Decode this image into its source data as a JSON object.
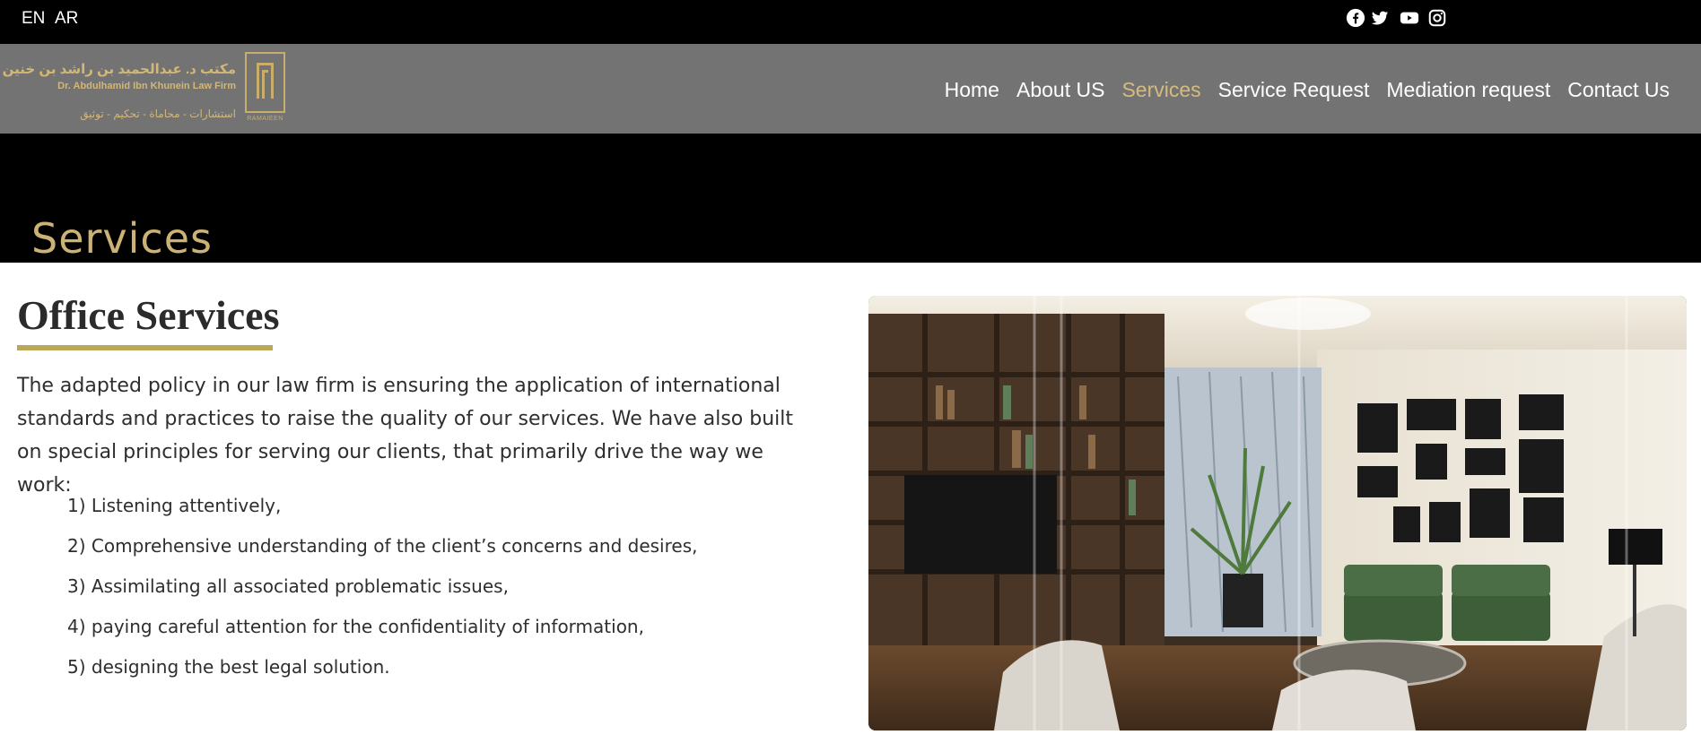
{
  "topbar": {
    "lang_en": "EN",
    "lang_ar": "AR",
    "social": [
      "facebook-icon",
      "twitter-icon",
      "youtube-icon",
      "instagram-icon"
    ]
  },
  "logo": {
    "arabic_name": "مكتب د. عبدالحميد بن راشد بن خنين",
    "english_name": "Dr. Abdulhamid Ibn Khunein Law Firm",
    "arabic_services": "استشارات - محاماة - تحكيم - توثيق",
    "brand": "RAMAIEEN"
  },
  "nav": {
    "items": [
      {
        "label": "Home",
        "active": false
      },
      {
        "label": "About US",
        "active": false
      },
      {
        "label": "Services",
        "active": true
      },
      {
        "label": "Service Request",
        "active": false
      },
      {
        "label": "Mediation request",
        "active": false
      },
      {
        "label": "Contact Us",
        "active": false
      }
    ]
  },
  "hero": {
    "title": "Services"
  },
  "main": {
    "title": "Office Services",
    "intro": "The adapted policy in our law firm is ensuring the application of international standards and practices to raise the quality of our services. We have also built on special principles for serving our clients, that primarily drive the way we work:",
    "list": [
      "1) Listening attentively,",
      "2) Comprehensive understanding of the client’s concerns and desires,",
      "3) Assimilating all associated problematic issues,",
      "4) paying careful attention for the confidentiality of information,",
      "5) designing the best legal solution."
    ]
  },
  "colors": {
    "gold": "#cdb276",
    "nav_bg": "#737373",
    "underline": "#bca658"
  }
}
